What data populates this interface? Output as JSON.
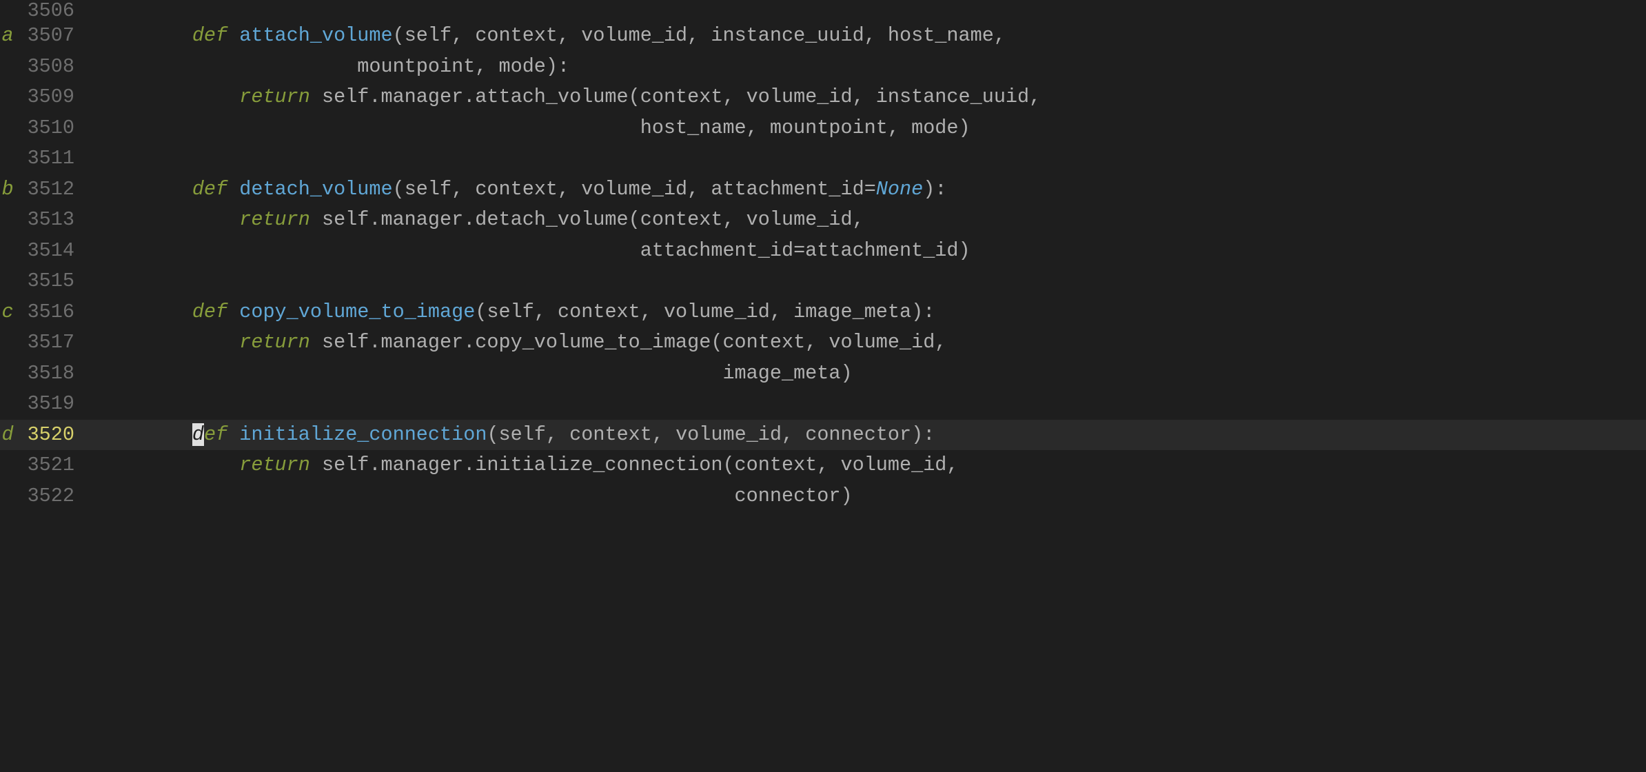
{
  "colors": {
    "bg": "#1e1e1e",
    "current_line_bg": "#2a2a2a",
    "lineno": "#6e6e6e",
    "lineno_current": "#d7d06a",
    "mark": "#879d3b",
    "kw": "#879d3b",
    "fn": "#60a7d6",
    "lit": "#60a7d6",
    "text": "#b0b0b0",
    "cursor": "#e0e0e0"
  },
  "marks": {
    "l3507": "a",
    "l3512": "b",
    "l3516": "c",
    "l3520": "d"
  },
  "linenos": {
    "l3506": "3506",
    "l3507": "3507",
    "l3508": "3508",
    "l3509": "3509",
    "l3510": "3510",
    "l3511": "3511",
    "l3512": "3512",
    "l3513": "3513",
    "l3514": "3514",
    "l3515": "3515",
    "l3516": "3516",
    "l3517": "3517",
    "l3518": "3518",
    "l3519": "3519",
    "l3520": "3520",
    "l3521": "3521",
    "l3522": "3522"
  },
  "tok": {
    "def": "def",
    "return": "return",
    "none": "None",
    "attach_volume": "attach_volume",
    "detach_volume": "detach_volume",
    "copy_volume_to_image": "copy_volume_to_image",
    "initialize_connection": "initialize_connection"
  },
  "txt": {
    "l3507_rest": "(self, context, volume_id, instance_uuid, host_name,",
    "l3508": "                      mountpoint, mode):",
    "l3509_a": "            ",
    "l3509_b": " self.manager.attach_volume(context, volume_id, instance_uuid,",
    "l3510": "                                              host_name, mountpoint, mode)",
    "l3512_rest_a": "(self, context, volume_id, attachment_id=",
    "l3512_rest_b": "):",
    "l3513_a": "            ",
    "l3513_b": " self.manager.detach_volume(context, volume_id,",
    "l3514": "                                              attachment_id=attachment_id)",
    "l3516_rest": "(self, context, volume_id, image_meta):",
    "l3517_a": "            ",
    "l3517_b": " self.manager.copy_volume_to_image(context, volume_id,",
    "l3518": "                                                     image_meta)",
    "l3520_rest": "(self, context, volume_id, connector):",
    "l3520_def_first": "d",
    "l3520_def_rest": "ef",
    "l3521_a": "            ",
    "l3521_b": " self.manager.initialize_connection(context, volume_id,",
    "l3522": "                                                      connector)",
    "indent8": "        ",
    "space": " "
  }
}
